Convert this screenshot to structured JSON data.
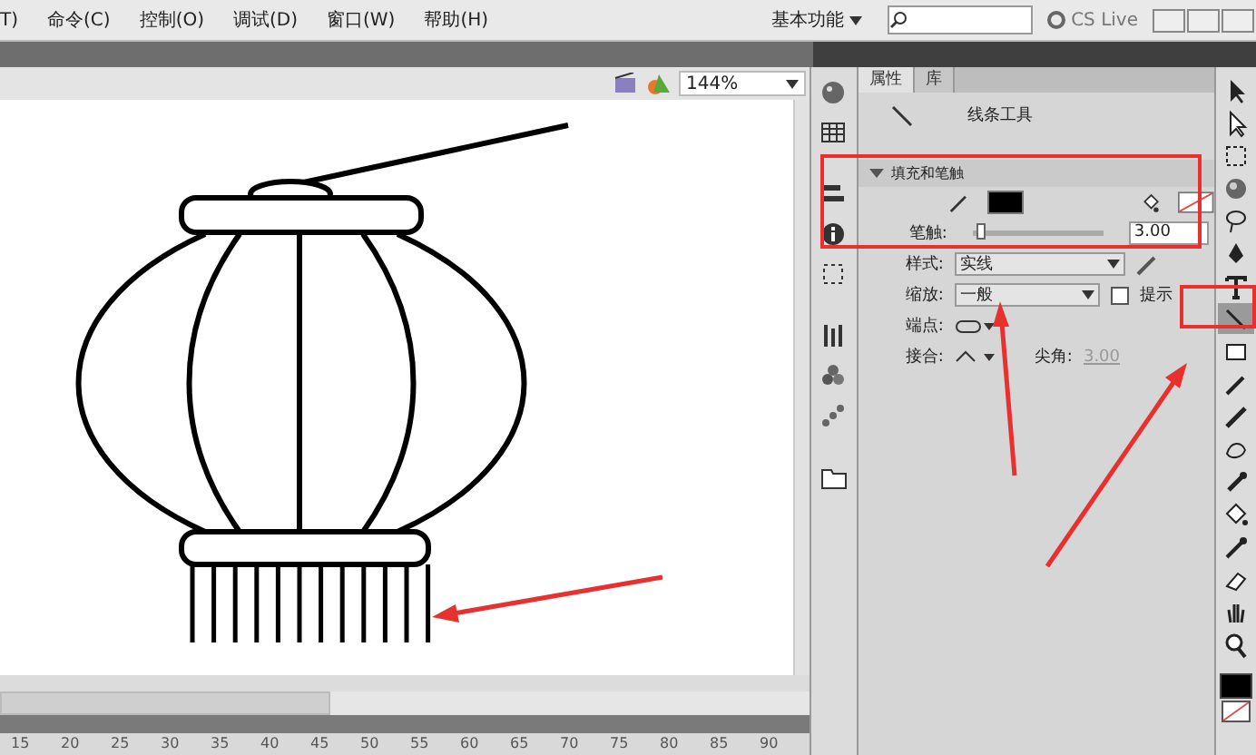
{
  "menu": [
    "T)",
    "命令(C)",
    "控制(O)",
    "调试(D)",
    "窗口(W)",
    "帮助(H)"
  ],
  "workspace": "基本功能",
  "cs_live": "CS Live",
  "stage": {
    "zoom": "144%"
  },
  "panel_tabs": [
    {
      "label": "属性",
      "selected": true
    },
    {
      "label": "库",
      "selected": false
    }
  ],
  "tool_name": "线条工具",
  "section": {
    "title": "填充和笔触",
    "expanded": true
  },
  "stroke": {
    "label": "笔触:",
    "level": 0.03,
    "value": "3.00"
  },
  "style": {
    "label": "样式:",
    "value": "实线"
  },
  "scale": {
    "label": "缩放:",
    "value": "一般"
  },
  "hint": {
    "label": "提示",
    "checked": false
  },
  "cap": {
    "label": "端点:"
  },
  "join": {
    "label": "接合:"
  },
  "miter": {
    "label": "尖角:",
    "value": "3.00"
  },
  "tools": [
    {
      "kind": "select",
      "selected": false
    },
    {
      "kind": "subselect",
      "selected": false
    },
    {
      "kind": "transform",
      "selected": false
    },
    {
      "kind": "sphere",
      "selected": false
    },
    {
      "kind": "lasso",
      "selected": false
    },
    {
      "kind": "pen",
      "selected": false
    },
    {
      "kind": "text",
      "selected": false
    },
    {
      "kind": "line",
      "selected": true
    },
    {
      "kind": "rect",
      "selected": false
    },
    {
      "kind": "pencil",
      "selected": false
    },
    {
      "kind": "brush",
      "selected": false
    },
    {
      "kind": "deco",
      "selected": false
    },
    {
      "kind": "bone",
      "selected": false
    },
    {
      "kind": "bucket",
      "selected": false
    },
    {
      "kind": "dropper",
      "selected": false
    },
    {
      "kind": "eraser",
      "selected": false
    },
    {
      "kind": "hand",
      "selected": false
    },
    {
      "kind": "zoom",
      "selected": false
    }
  ],
  "ruler": [
    "15",
    "20",
    "25",
    "30",
    "35",
    "40",
    "45",
    "50",
    "55",
    "60",
    "65",
    "70",
    "75",
    "80",
    "85",
    "90"
  ]
}
